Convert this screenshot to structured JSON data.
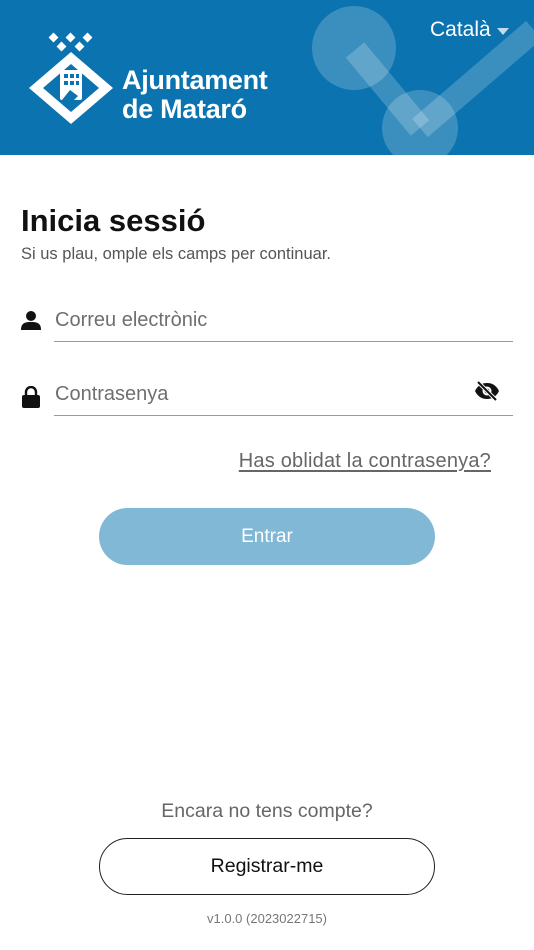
{
  "header": {
    "brand_line1": "Ajuntament",
    "brand_line2": "de Mataró",
    "language": "Català",
    "background_color": "#0a73b0"
  },
  "login": {
    "title": "Inicia sessió",
    "subtitle": "Si us plau, omple els camps per continuar.",
    "email_placeholder": "Correu electrònic",
    "email_value": "",
    "password_placeholder": "Contrasenya",
    "password_value": "",
    "email_icon": "user-icon",
    "password_icon": "lock-icon",
    "visibility_icon": "eye-off-icon",
    "forgot_password": "Has oblidat la contrasenya?",
    "submit_label": "Entrar",
    "submit_color": "#80b8d5"
  },
  "footer": {
    "no_account_text": "Encara no tens compte?",
    "register_label": "Registrar-me",
    "version": "v1.0.0 (2023022715)"
  }
}
